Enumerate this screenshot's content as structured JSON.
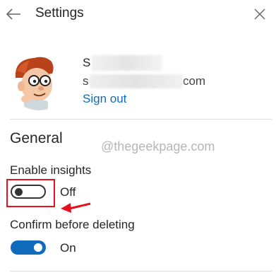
{
  "header": {
    "title": "Settings",
    "back_icon": "arrow-left-icon",
    "close_icon": "close-icon"
  },
  "account": {
    "name": "S          nu",
    "email": "s             4@gmail.com",
    "sign_out": "Sign out",
    "avatar_icon": "cartoon-avatar"
  },
  "general": {
    "title": "General",
    "watermark": "@thegeekpage.com",
    "settings": [
      {
        "label": "Enable insights",
        "state": "Off",
        "on": false
      },
      {
        "label": "Confirm before deleting",
        "state": "On",
        "on": true
      }
    ]
  },
  "colors": {
    "accent": "#0f6cbd",
    "annotation": "#e5111c"
  }
}
